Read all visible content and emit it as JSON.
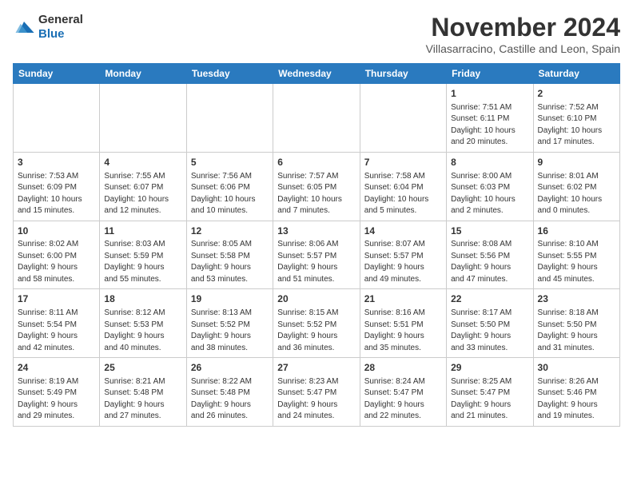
{
  "header": {
    "logo": {
      "general": "General",
      "blue": "Blue"
    },
    "month_title": "November 2024",
    "subtitle": "Villasarracino, Castille and Leon, Spain"
  },
  "weekdays": [
    "Sunday",
    "Monday",
    "Tuesday",
    "Wednesday",
    "Thursday",
    "Friday",
    "Saturday"
  ],
  "weeks": [
    [
      {
        "day": "",
        "info": ""
      },
      {
        "day": "",
        "info": ""
      },
      {
        "day": "",
        "info": ""
      },
      {
        "day": "",
        "info": ""
      },
      {
        "day": "",
        "info": ""
      },
      {
        "day": "1",
        "info": "Sunrise: 7:51 AM\nSunset: 6:11 PM\nDaylight: 10 hours\nand 20 minutes."
      },
      {
        "day": "2",
        "info": "Sunrise: 7:52 AM\nSunset: 6:10 PM\nDaylight: 10 hours\nand 17 minutes."
      }
    ],
    [
      {
        "day": "3",
        "info": "Sunrise: 7:53 AM\nSunset: 6:09 PM\nDaylight: 10 hours\nand 15 minutes."
      },
      {
        "day": "4",
        "info": "Sunrise: 7:55 AM\nSunset: 6:07 PM\nDaylight: 10 hours\nand 12 minutes."
      },
      {
        "day": "5",
        "info": "Sunrise: 7:56 AM\nSunset: 6:06 PM\nDaylight: 10 hours\nand 10 minutes."
      },
      {
        "day": "6",
        "info": "Sunrise: 7:57 AM\nSunset: 6:05 PM\nDaylight: 10 hours\nand 7 minutes."
      },
      {
        "day": "7",
        "info": "Sunrise: 7:58 AM\nSunset: 6:04 PM\nDaylight: 10 hours\nand 5 minutes."
      },
      {
        "day": "8",
        "info": "Sunrise: 8:00 AM\nSunset: 6:03 PM\nDaylight: 10 hours\nand 2 minutes."
      },
      {
        "day": "9",
        "info": "Sunrise: 8:01 AM\nSunset: 6:02 PM\nDaylight: 10 hours\nand 0 minutes."
      }
    ],
    [
      {
        "day": "10",
        "info": "Sunrise: 8:02 AM\nSunset: 6:00 PM\nDaylight: 9 hours\nand 58 minutes."
      },
      {
        "day": "11",
        "info": "Sunrise: 8:03 AM\nSunset: 5:59 PM\nDaylight: 9 hours\nand 55 minutes."
      },
      {
        "day": "12",
        "info": "Sunrise: 8:05 AM\nSunset: 5:58 PM\nDaylight: 9 hours\nand 53 minutes."
      },
      {
        "day": "13",
        "info": "Sunrise: 8:06 AM\nSunset: 5:57 PM\nDaylight: 9 hours\nand 51 minutes."
      },
      {
        "day": "14",
        "info": "Sunrise: 8:07 AM\nSunset: 5:57 PM\nDaylight: 9 hours\nand 49 minutes."
      },
      {
        "day": "15",
        "info": "Sunrise: 8:08 AM\nSunset: 5:56 PM\nDaylight: 9 hours\nand 47 minutes."
      },
      {
        "day": "16",
        "info": "Sunrise: 8:10 AM\nSunset: 5:55 PM\nDaylight: 9 hours\nand 45 minutes."
      }
    ],
    [
      {
        "day": "17",
        "info": "Sunrise: 8:11 AM\nSunset: 5:54 PM\nDaylight: 9 hours\nand 42 minutes."
      },
      {
        "day": "18",
        "info": "Sunrise: 8:12 AM\nSunset: 5:53 PM\nDaylight: 9 hours\nand 40 minutes."
      },
      {
        "day": "19",
        "info": "Sunrise: 8:13 AM\nSunset: 5:52 PM\nDaylight: 9 hours\nand 38 minutes."
      },
      {
        "day": "20",
        "info": "Sunrise: 8:15 AM\nSunset: 5:52 PM\nDaylight: 9 hours\nand 36 minutes."
      },
      {
        "day": "21",
        "info": "Sunrise: 8:16 AM\nSunset: 5:51 PM\nDaylight: 9 hours\nand 35 minutes."
      },
      {
        "day": "22",
        "info": "Sunrise: 8:17 AM\nSunset: 5:50 PM\nDaylight: 9 hours\nand 33 minutes."
      },
      {
        "day": "23",
        "info": "Sunrise: 8:18 AM\nSunset: 5:50 PM\nDaylight: 9 hours\nand 31 minutes."
      }
    ],
    [
      {
        "day": "24",
        "info": "Sunrise: 8:19 AM\nSunset: 5:49 PM\nDaylight: 9 hours\nand 29 minutes."
      },
      {
        "day": "25",
        "info": "Sunrise: 8:21 AM\nSunset: 5:48 PM\nDaylight: 9 hours\nand 27 minutes."
      },
      {
        "day": "26",
        "info": "Sunrise: 8:22 AM\nSunset: 5:48 PM\nDaylight: 9 hours\nand 26 minutes."
      },
      {
        "day": "27",
        "info": "Sunrise: 8:23 AM\nSunset: 5:47 PM\nDaylight: 9 hours\nand 24 minutes."
      },
      {
        "day": "28",
        "info": "Sunrise: 8:24 AM\nSunset: 5:47 PM\nDaylight: 9 hours\nand 22 minutes."
      },
      {
        "day": "29",
        "info": "Sunrise: 8:25 AM\nSunset: 5:47 PM\nDaylight: 9 hours\nand 21 minutes."
      },
      {
        "day": "30",
        "info": "Sunrise: 8:26 AM\nSunset: 5:46 PM\nDaylight: 9 hours\nand 19 minutes."
      }
    ]
  ]
}
